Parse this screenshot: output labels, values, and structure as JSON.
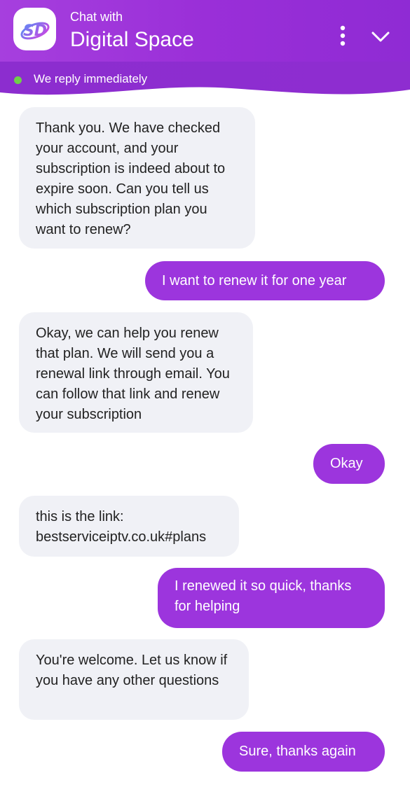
{
  "header": {
    "subtitle": "Chat with",
    "title": "Digital Space",
    "logo_text": "SD",
    "status": "We reply immediately"
  },
  "messages": [
    {
      "from": "bot",
      "text": "Thank you. We have checked your account, and your subscription is indeed about to expire soon. Can you tell us which subscription plan you want to renew?"
    },
    {
      "from": "user",
      "text": "I want to renew it for one year"
    },
    {
      "from": "bot",
      "text": "Okay, we can help you renew that plan. We will send you a renewal link through email. You can follow that link and renew your subscription"
    },
    {
      "from": "user",
      "text": "Okay"
    },
    {
      "from": "bot",
      "text": "this is the link: bestserviceiptv.co.uk#plans"
    },
    {
      "from": "user",
      "text": "I renewed it so quick, thanks for helping"
    },
    {
      "from": "bot",
      "text": "You're welcome. Let us know if you have any other questions"
    },
    {
      "from": "user",
      "text": "Sure, thanks again"
    }
  ],
  "icons": {
    "menu": "more-vertical-icon",
    "collapse": "chevron-down-icon"
  },
  "colors": {
    "header": "#9a2fd8",
    "user_bubble": "#9c35dd",
    "bot_bubble": "#f0f1f6",
    "status_dot": "#6fcf4a"
  }
}
